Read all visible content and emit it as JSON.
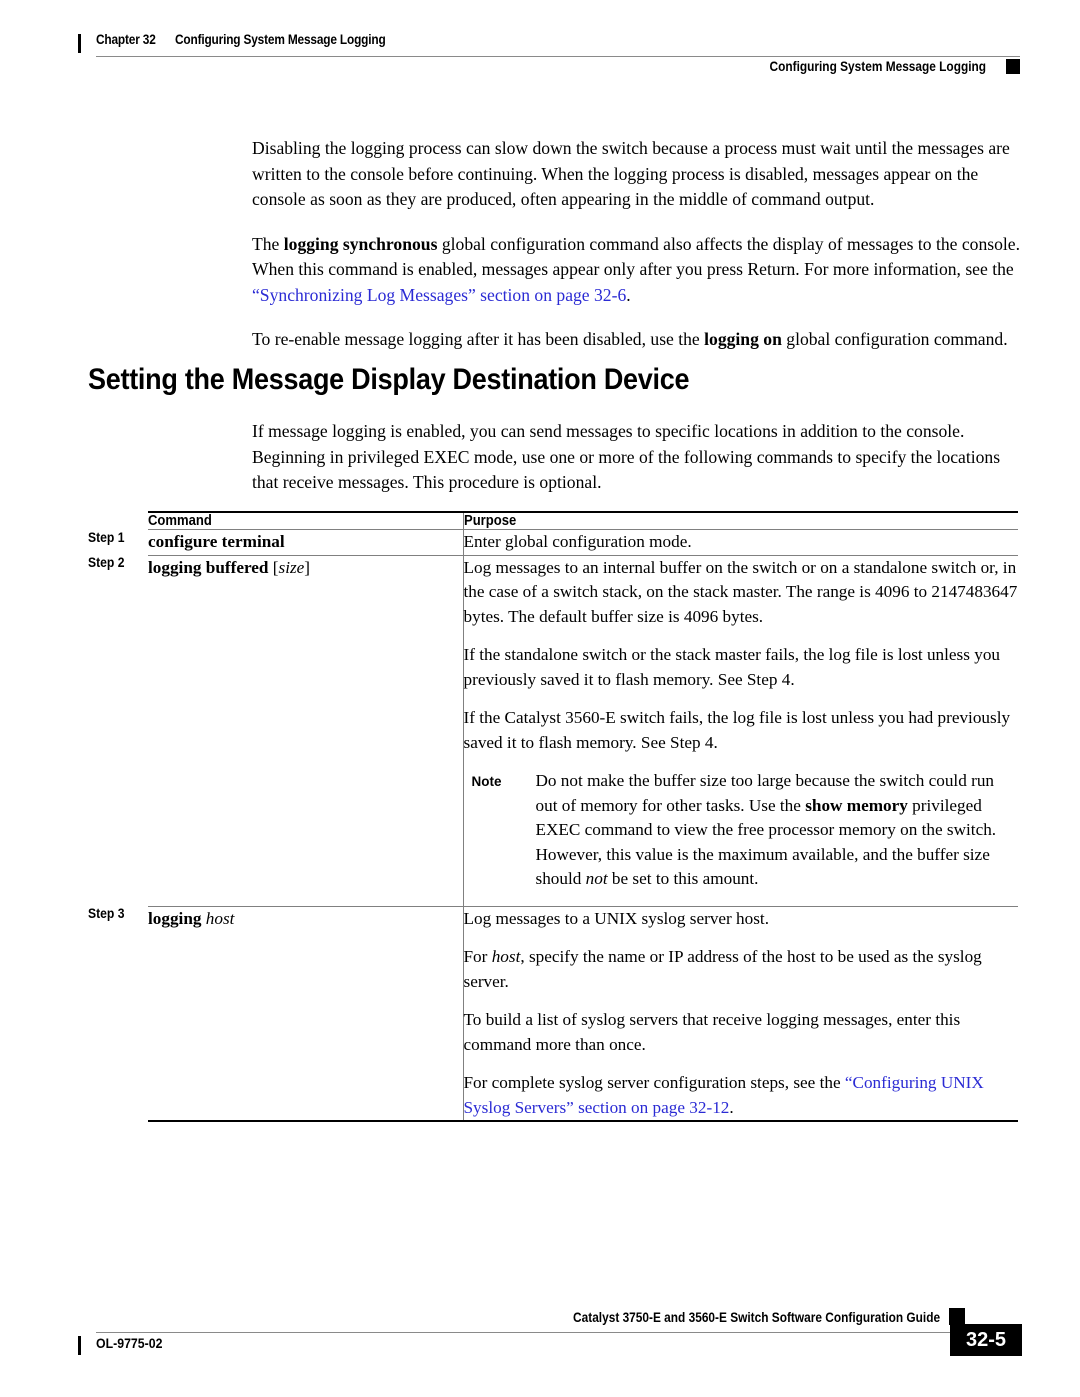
{
  "header": {
    "chapter_number": "Chapter 32",
    "chapter_title": "Configuring System Message Logging",
    "running_head": "Configuring System Message Logging"
  },
  "intro": {
    "para1": "Disabling the logging process can slow down the switch because a process must wait until the messages are written to the console before continuing. When the logging process is disabled, messages appear on the console as soon as they are produced, often appearing in the middle of command output.",
    "para2_pre": "The ",
    "para2_cmd": "logging synchronous",
    "para2_mid": " global configuration command also affects the display of messages to the console. When this command is enabled, messages appear only after you press Return. For more information, see the ",
    "para2_link": "“Synchronizing Log Messages” section on page 32-6",
    "para2_post": ".",
    "para3_pre": "To re-enable message logging after it has been disabled, use the ",
    "para3_cmd": "logging on",
    "para3_post": " global configuration command."
  },
  "section": {
    "heading": "Setting the Message Display Destination Device",
    "intro": "If message logging is enabled, you can send messages to specific locations in addition to the console. Beginning in privileged EXEC mode, use one or more of the following commands to specify the locations that receive messages. This procedure is optional."
  },
  "table": {
    "headers": {
      "step": "",
      "command": "Command",
      "purpose": "Purpose"
    },
    "rows": [
      {
        "step": "Step 1",
        "command_main": "configure terminal",
        "command_arg": "",
        "purpose": [
          "Enter global configuration mode."
        ]
      },
      {
        "step": "Step 2",
        "command_main": "logging buffered",
        "command_arg": "size",
        "purpose": [
          "Log messages to an internal buffer on the switch or on a standalone switch or, in the case of a switch stack, on the stack master. The range is 4096 to 2147483647 bytes. The default buffer size is 4096 bytes.",
          "If the standalone switch or the stack master fails, the log file is lost unless you previously saved it to flash memory. See Step 4.",
          "If the Catalyst 3560-E switch fails, the log file is lost unless you had previously saved it to flash memory. See Step 4."
        ],
        "note": {
          "label": "Note",
          "text_pre": "Do not make the buffer size too large because the switch could run out of memory for other tasks. Use the ",
          "text_bold": "show memory",
          "text_mid": " privileged EXEC command to view the free processor memory on the switch. However, this value is the maximum available, and the buffer size should ",
          "text_italic": "not",
          "text_post": " be set to this amount."
        }
      },
      {
        "step": "Step 3",
        "command_main": "logging",
        "command_arg": "host",
        "purpose_rich": {
          "p1": "Log messages to a UNIX syslog server host.",
          "p2_pre": "For ",
          "p2_italic": "host",
          "p2_post": ", specify the name or IP address of the host to be used as the syslog server.",
          "p3": "To build a list of syslog servers that receive logging messages, enter this command more than once.",
          "p4_pre": "For complete syslog server configuration steps, see the ",
          "p4_link": "“Configuring UNIX Syslog Servers” section on page 32-12",
          "p4_post": "."
        }
      }
    ]
  },
  "footer": {
    "guide_title": "Catalyst 3750-E and 3560-E Switch Software Configuration Guide",
    "doc_id": "OL-9775-02",
    "page_number": "32-5"
  },
  "colors": {
    "link": "#2b2bd4",
    "rule": "#808080",
    "text": "#000000"
  }
}
